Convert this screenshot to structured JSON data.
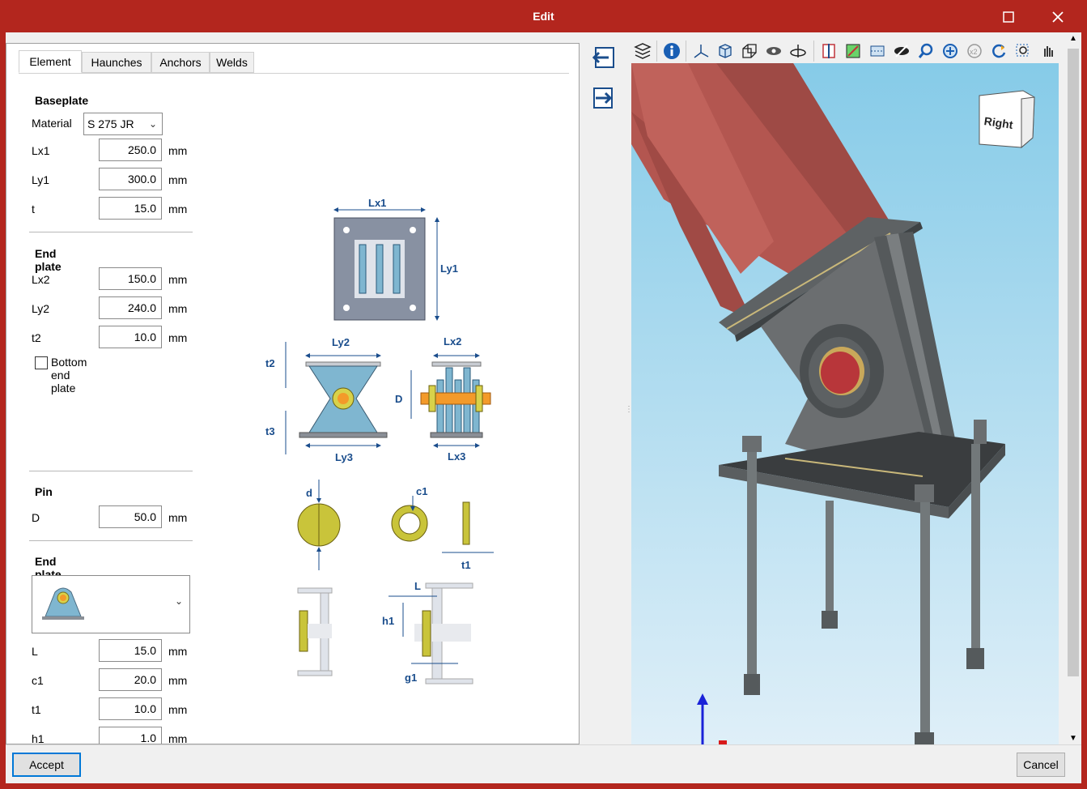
{
  "window": {
    "title": "Edit"
  },
  "tabs": [
    {
      "label": "Element",
      "active": true
    },
    {
      "label": "Haunches",
      "active": false
    },
    {
      "label": "Anchors",
      "active": false
    },
    {
      "label": "Welds",
      "active": false
    }
  ],
  "baseplate": {
    "title": "Baseplate",
    "material_label": "Material",
    "material_value": "S 275 JR",
    "fields": [
      {
        "label": "Lx1",
        "value": "250.0",
        "unit": "mm"
      },
      {
        "label": "Ly1",
        "value": "300.0",
        "unit": "mm"
      },
      {
        "label": "t",
        "value": "15.0",
        "unit": "mm"
      }
    ]
  },
  "end_plate": {
    "title": "End plate",
    "fields": [
      {
        "label": "Lx2",
        "value": "150.0",
        "unit": "mm"
      },
      {
        "label": "Ly2",
        "value": "240.0",
        "unit": "mm"
      },
      {
        "label": "t2",
        "value": "10.0",
        "unit": "mm"
      }
    ],
    "bottom_checkbox_label": "Bottom end plate",
    "bottom_checked": false
  },
  "pin": {
    "title": "Pin",
    "fields": [
      {
        "label": "D",
        "value": "50.0",
        "unit": "mm"
      }
    ]
  },
  "end_plate2": {
    "title": "End plate",
    "fields": [
      {
        "label": "L",
        "value": "15.0",
        "unit": "mm"
      },
      {
        "label": "c1",
        "value": "20.0",
        "unit": "mm"
      },
      {
        "label": "t1",
        "value": "10.0",
        "unit": "mm"
      },
      {
        "label": "h1",
        "value": "1.0",
        "unit": "mm"
      }
    ]
  },
  "diagram_labels": {
    "lx1": "Lx1",
    "ly1": "Ly1",
    "ly2": "Ly2",
    "lx2": "Lx2",
    "t2": "t2",
    "t3": "t3",
    "d_upper": "D",
    "ly3": "Ly3",
    "lx3": "Lx3",
    "d_lower": "d",
    "c1": "c1",
    "t1": "t1",
    "l": "L",
    "h1": "h1",
    "g1": "g1"
  },
  "viewcube_label": "Right",
  "buttons": {
    "accept": "Accept",
    "cancel": "Cancel"
  },
  "colors": {
    "titlebar": "#b3261e",
    "beam": "#b85a55",
    "steel": "#6f7274",
    "pin": "#c0343a",
    "accent": "#0078d7"
  }
}
